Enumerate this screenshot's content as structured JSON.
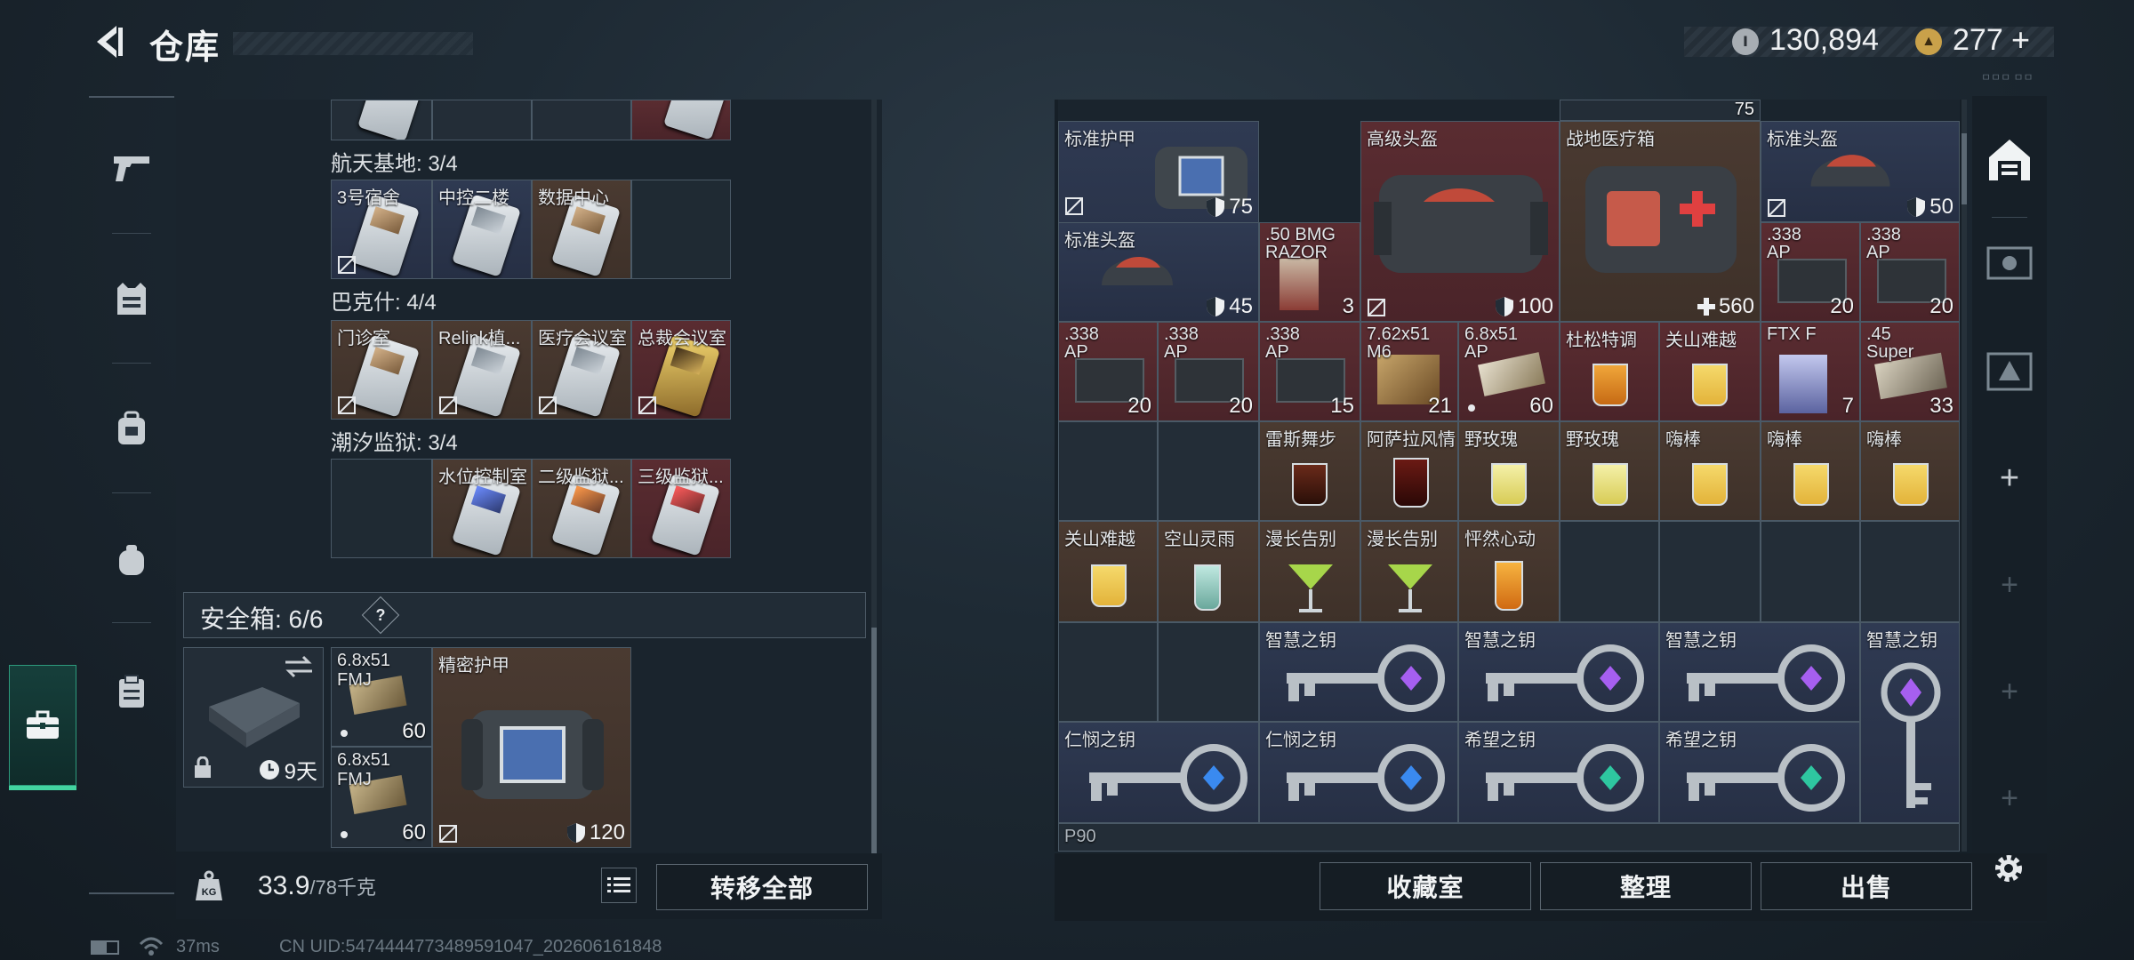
{
  "header": {
    "title": "仓库",
    "currency1": "130,894",
    "currency2": "277",
    "currency2_plus": "+",
    "tiny_label": "ㅁㅁㅁ ㅁㅁ"
  },
  "sidebar": {
    "items": [
      "pistol-icon",
      "vest-icon",
      "backpack-icon",
      "pack-icon",
      "clipboard-icon",
      "briefcase-icon"
    ]
  },
  "left": {
    "groups": [
      {
        "title": "航天基地: 3/4",
        "cells": [
          {
            "name": "3号宿舍",
            "color": "c-blue",
            "card": "tan"
          },
          {
            "name": "中控二楼",
            "color": "c-blue",
            "card": ""
          },
          {
            "name": "数据中心",
            "color": "c-brown",
            "card": "tan"
          },
          {
            "name": "",
            "color": "c-empty",
            "card": ""
          }
        ]
      },
      {
        "title": "巴克什: 4/4",
        "cells": [
          {
            "name": "门诊室",
            "color": "c-brown",
            "card": "tan"
          },
          {
            "name": "Relink植...",
            "color": "c-brown",
            "card": ""
          },
          {
            "name": "医疗会议室",
            "color": "c-brown",
            "card": ""
          },
          {
            "name": "总裁会议室",
            "color": "c-red",
            "card": "gold"
          }
        ]
      },
      {
        "title": "潮汐监狱: 3/4",
        "cells": [
          {
            "name": "",
            "color": "c-empty",
            "card": ""
          },
          {
            "name": "水位控制室",
            "color": "c-brown",
            "card": "blue"
          },
          {
            "name": "二级监狱...",
            "color": "c-brown",
            "card": "orange"
          },
          {
            "name": "三级监狱...",
            "color": "c-red",
            "card": "red"
          }
        ]
      }
    ],
    "safe_title": "安全箱: 6/6",
    "safe_q": "?",
    "safe": {
      "box_duration": "9天",
      "ammo1_name": "6.8x51 FMJ",
      "ammo1_count": "60",
      "ammo2_name": "6.8x51 FMJ",
      "ammo2_count": "60",
      "armor_name": "精密护甲",
      "armor_value": "120"
    },
    "weight": "33.9",
    "weight_max": "/78千克",
    "transfer_all": "转移全部"
  },
  "right": {
    "top_partial_value": "75",
    "row1": [
      {
        "name": "标准护甲",
        "value": "75",
        "color": "c-blue"
      },
      {
        "name": "高级头盔",
        "value": "100",
        "color": "c-red"
      },
      {
        "name": "战地医疗箱",
        "value": "560",
        "color": "c-brown"
      },
      {
        "name": "标准头盔",
        "value": "50",
        "color": "c-blue"
      }
    ],
    "row2": [
      {
        "name": "标准头盔",
        "value": "45"
      },
      {
        "name": ".50 BMG RAZOR",
        "value": "3"
      },
      {
        "name": ".338 AP",
        "value": "20"
      },
      {
        "name": ".338 AP",
        "value": "20"
      }
    ],
    "row3": [
      {
        "name": ".338 AP",
        "value": "20"
      },
      {
        "name": ".338 AP",
        "value": "20"
      },
      {
        "name": ".338 AP",
        "value": "15"
      },
      {
        "name": "7.62x51 M6",
        "value": "21"
      },
      {
        "name": "6.8x51 AP",
        "value": "60"
      },
      {
        "name": "杜松特调",
        "value": ""
      },
      {
        "name": "关山难越",
        "value": ""
      },
      {
        "name": "FTX F",
        "value": "7"
      },
      {
        "name": ".45 Super",
        "value": "33"
      }
    ],
    "row4": [
      {
        "name": "雷斯舞步"
      },
      {
        "name": "阿萨拉风情"
      },
      {
        "name": "野玫瑰"
      },
      {
        "name": "野玫瑰"
      },
      {
        "name": "嗨棒"
      },
      {
        "name": "嗨棒"
      },
      {
        "name": "嗨棒"
      }
    ],
    "row5": [
      {
        "name": "关山难越"
      },
      {
        "name": "空山灵雨"
      },
      {
        "name": "漫长告别"
      },
      {
        "name": "漫长告别"
      },
      {
        "name": "怦然心动"
      }
    ],
    "row6": [
      {
        "name": "智慧之钥"
      },
      {
        "name": "智慧之钥"
      },
      {
        "name": "智慧之钥"
      },
      {
        "name": "智慧之钥"
      }
    ],
    "row7": [
      {
        "name": "仁悯之钥"
      },
      {
        "name": "仁悯之钥"
      },
      {
        "name": "希望之钥"
      },
      {
        "name": "希望之钥"
      }
    ],
    "row8_partial": "P90"
  },
  "footer": {
    "collection": "收藏室",
    "organize": "整理",
    "sell": "出售"
  },
  "status": {
    "ping": "37ms",
    "uid": "CN UID:5474444773489591047_202606161848"
  },
  "colors": {
    "accent": "#43d4a0",
    "red_cell": "#5a2c31",
    "blue_cell": "#2f3a52",
    "brown_cell": "#4a3a31"
  }
}
